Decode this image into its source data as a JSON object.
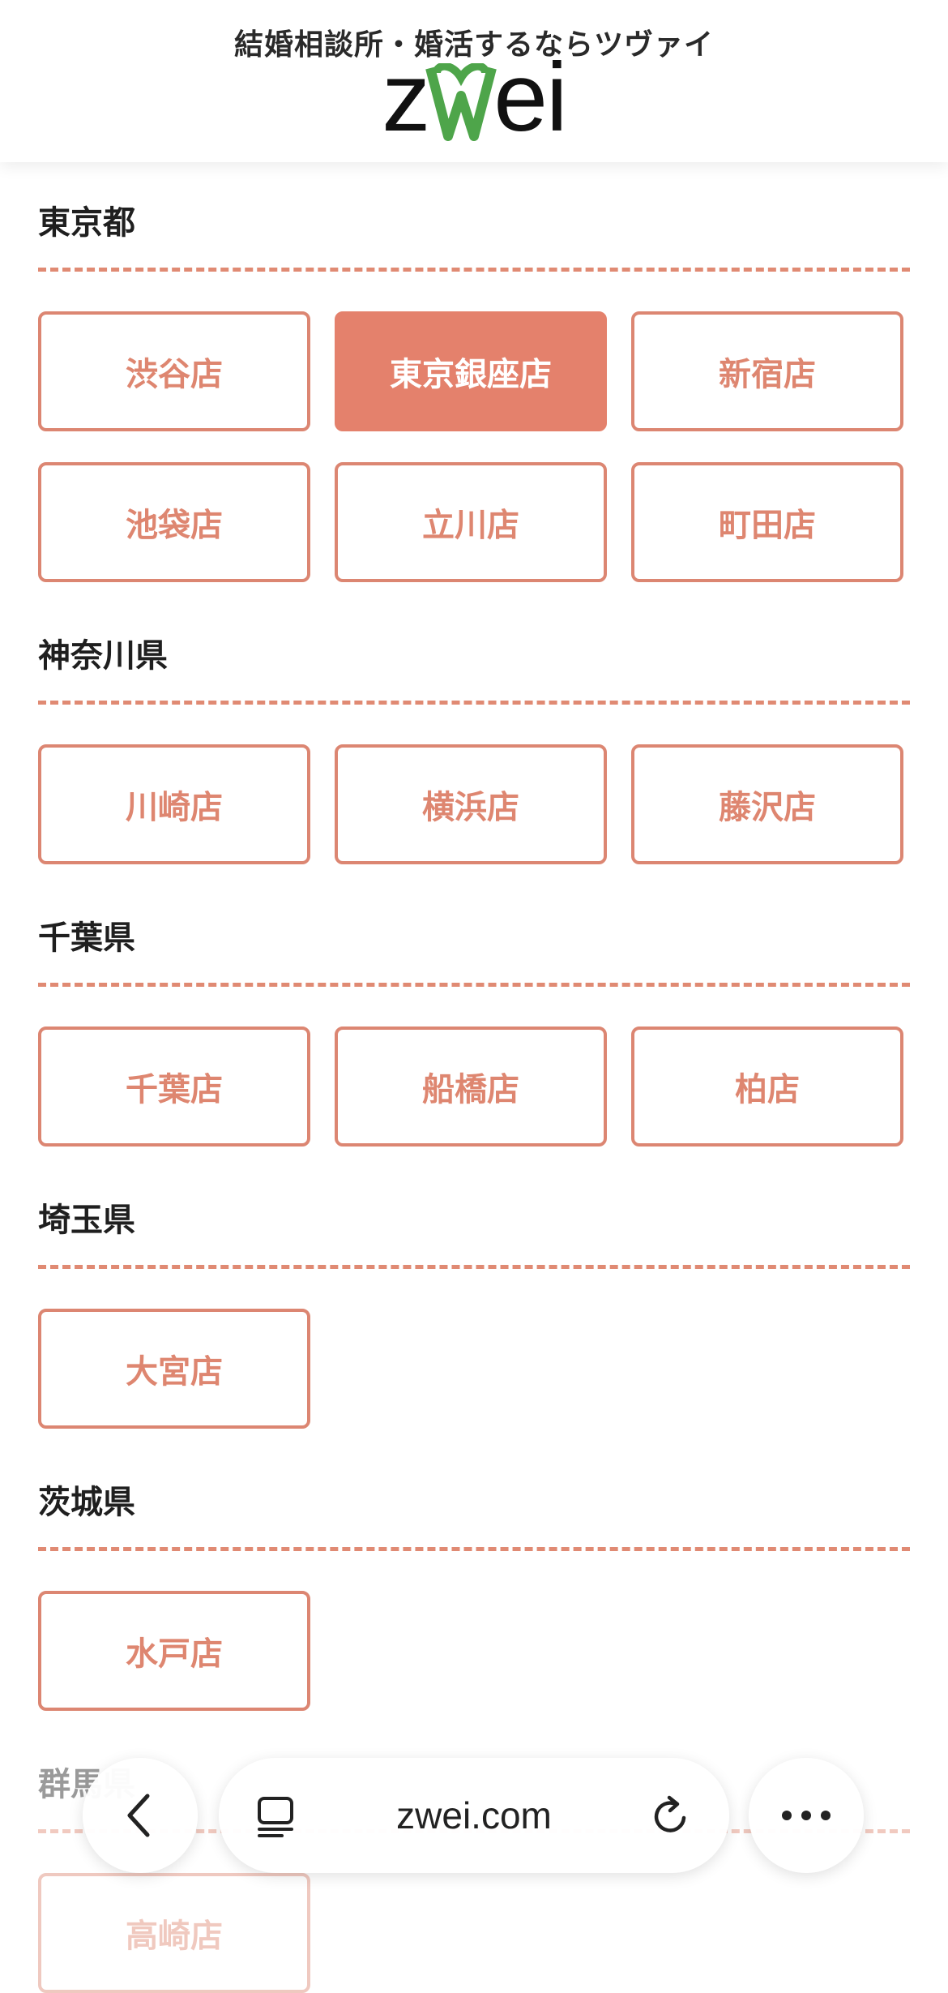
{
  "header": {
    "tagline": "結婚相談所・婚活するならツヴァイ",
    "logo_text_left": "z",
    "logo_text_right": "ei",
    "logo_heart_color": "#4ea54a"
  },
  "sections": [
    {
      "title": "東京都",
      "stores": [
        "渋谷店",
        "東京銀座店",
        "新宿店",
        "池袋店",
        "立川店",
        "町田店"
      ],
      "active": "東京銀座店"
    },
    {
      "title": "神奈川県",
      "stores": [
        "川崎店",
        "横浜店",
        "藤沢店"
      ]
    },
    {
      "title": "千葉県",
      "stores": [
        "千葉店",
        "船橋店",
        "柏店"
      ]
    },
    {
      "title": "埼玉県",
      "stores": [
        "大宮店"
      ]
    },
    {
      "title": "茨城県",
      "stores": [
        "水戸店"
      ]
    },
    {
      "title": "群馬県",
      "stores": [
        "高崎店"
      ]
    }
  ],
  "browser": {
    "url": "zwei.com",
    "back_icon": "chevron-left-icon",
    "tabs_icon": "tabs-icon",
    "reload_icon": "reload-icon",
    "more_icon": "more-icon"
  },
  "colors": {
    "accent": "#e4816c",
    "accent_text": "#de8670",
    "rule": "#e08a73"
  }
}
